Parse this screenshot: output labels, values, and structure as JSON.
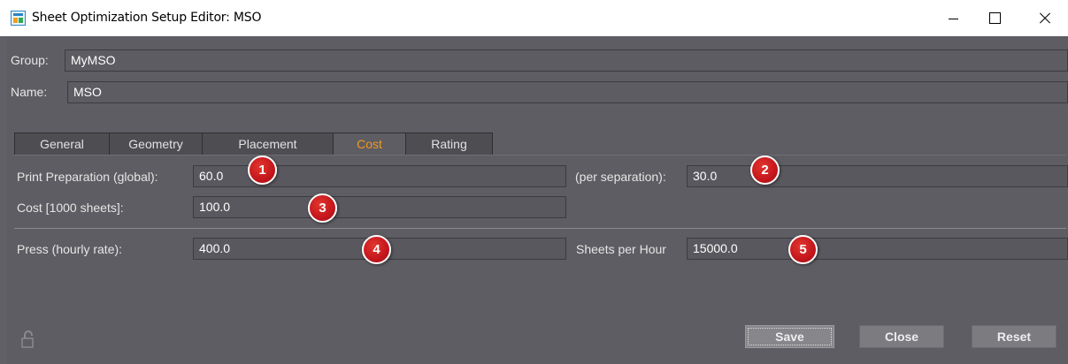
{
  "window": {
    "title": "Sheet Optimization Setup Editor: MSO",
    "app_icon": "sheet-optimizer-app-icon"
  },
  "header": {
    "group_label": "Group:",
    "group_value": "MyMSO",
    "name_label": "Name:",
    "name_value": "MSO"
  },
  "tabs": [
    {
      "label": "General",
      "active": false
    },
    {
      "label": "Geometry",
      "active": false
    },
    {
      "label": "Placement",
      "active": false
    },
    {
      "label": "Cost",
      "active": true
    },
    {
      "label": "Rating",
      "active": false
    }
  ],
  "cost": {
    "print_prep_label": "Print Preparation (global):",
    "print_prep_value": "60.0",
    "per_separation_label": "(per separation):",
    "per_separation_value": "30.0",
    "cost_1000_label": "Cost [1000 sheets]:",
    "cost_1000_value": "100.0",
    "press_label": "Press (hourly rate):",
    "press_value": "400.0",
    "sheets_per_hour_label": "Sheets per Hour",
    "sheets_per_hour_value": "15000.0"
  },
  "badges": [
    "1",
    "2",
    "3",
    "4",
    "5"
  ],
  "buttons": {
    "save": "Save",
    "close": "Close",
    "reset": "Reset"
  },
  "colors": {
    "active_tab": "#f39a1e",
    "badge": "#c4161c",
    "background": "#5d5d63"
  }
}
